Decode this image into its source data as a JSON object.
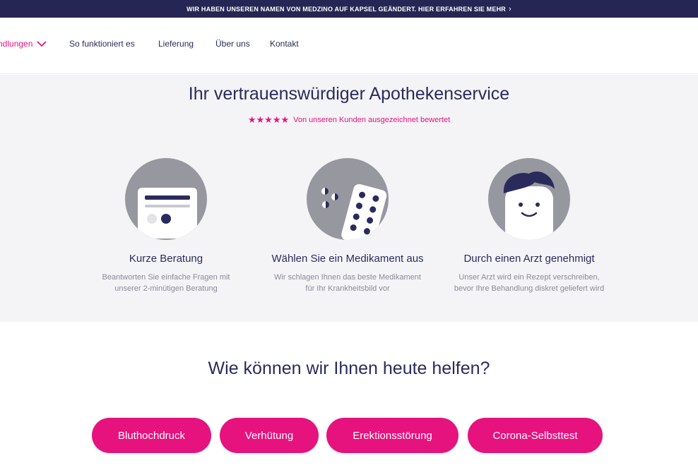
{
  "banner": {
    "text": "WIR HABEN UNSEREN NAMEN VON MEDZINO AUF KAPSEL GEÄNDERT. HIER ERFAHREN SIE MEHR",
    "chevron": "›"
  },
  "nav": {
    "items": [
      {
        "label": "ndlungen",
        "icon": "chevron-down-icon"
      },
      {
        "label": "So funktioniert es"
      },
      {
        "label": "Lieferung"
      },
      {
        "label": "Über uns"
      },
      {
        "label": "Kontakt"
      }
    ]
  },
  "hero": {
    "title": "Ihr vertrauenswürdiger Apothekenservice",
    "stars": "★★★★★",
    "rating_text": "Von unseren Kunden ausgezeichnet bewertet",
    "steps": [
      {
        "icon": "consultation-card-icon",
        "title": "Kurze Beratung",
        "desc1": "Beantworten Sie einfache Fragen mit",
        "desc2": "unserer 2-minütigen Beratung"
      },
      {
        "icon": "pill-pack-icon",
        "title": "Wählen Sie ein Medikament aus",
        "desc1": "Wir schlagen Ihnen das beste Medikament",
        "desc2": "für Ihr Krankheitsbild vor"
      },
      {
        "icon": "doctor-face-icon",
        "title": "Durch einen Arzt genehmigt",
        "desc1": "Unser Arzt wird ein Rezept verschreiben,",
        "desc2": "bevor Ihre Behandlung diskret geliefert wird"
      }
    ]
  },
  "help": {
    "title": "Wie können wir Ihnen heute helfen?",
    "categories": [
      "Bluthochdruck",
      "Verhütung",
      "Erektionsstörung",
      "Corona-Selbsttest"
    ]
  },
  "colors": {
    "accent": "#e6127e",
    "navy": "#262654",
    "hero_bg": "#f4f4f7",
    "icon_circle": "#97979f"
  }
}
